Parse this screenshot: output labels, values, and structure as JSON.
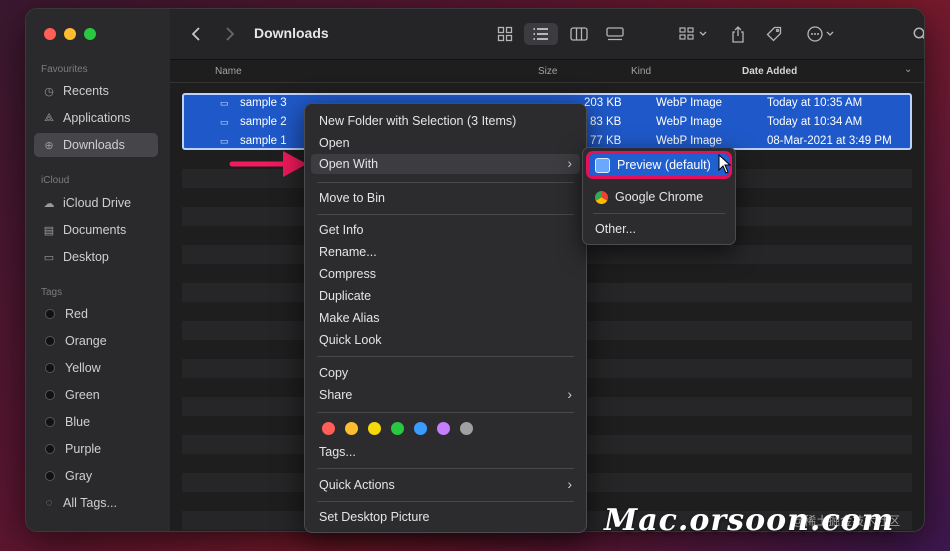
{
  "window": {
    "title": "Downloads"
  },
  "sidebar": {
    "sections": [
      {
        "title": "Favourites",
        "items": [
          {
            "label": "Recents",
            "icon": "clock-icon"
          },
          {
            "label": "Applications",
            "icon": "applications-icon"
          },
          {
            "label": "Downloads",
            "icon": "download-icon",
            "active": true
          }
        ]
      },
      {
        "title": "iCloud",
        "items": [
          {
            "label": "iCloud Drive",
            "icon": "cloud-icon"
          },
          {
            "label": "Documents",
            "icon": "document-icon"
          },
          {
            "label": "Desktop",
            "icon": "desktop-icon"
          }
        ]
      },
      {
        "title": "Tags",
        "items": [
          {
            "label": "Red",
            "icon": "tag-dot-icon"
          },
          {
            "label": "Orange",
            "icon": "tag-dot-icon"
          },
          {
            "label": "Yellow",
            "icon": "tag-dot-icon"
          },
          {
            "label": "Green",
            "icon": "tag-dot-icon"
          },
          {
            "label": "Blue",
            "icon": "tag-dot-icon"
          },
          {
            "label": "Purple",
            "icon": "tag-dot-icon"
          },
          {
            "label": "Gray",
            "icon": "tag-dot-icon"
          },
          {
            "label": "All Tags...",
            "icon": "all-tags-icon"
          }
        ]
      }
    ]
  },
  "columns": {
    "name": "Name",
    "size": "Size",
    "kind": "Kind",
    "date": "Date Added"
  },
  "files": [
    {
      "name": "sample 3",
      "size": "203 KB",
      "kind": "WebP Image",
      "date": "Today at 10:35 AM"
    },
    {
      "name": "sample 2",
      "size": "83 KB",
      "kind": "WebP Image",
      "date": "Today at 10:34 AM"
    },
    {
      "name": "sample 1",
      "size": "77 KB",
      "kind": "WebP Image",
      "date": "08-Mar-2021 at 3:49 PM"
    }
  ],
  "context_menu": {
    "new_folder": "New Folder with Selection (3 Items)",
    "open": "Open",
    "open_with": "Open With",
    "move_to_bin": "Move to Bin",
    "get_info": "Get Info",
    "rename": "Rename...",
    "compress": "Compress",
    "duplicate": "Duplicate",
    "make_alias": "Make Alias",
    "quick_look": "Quick Look",
    "copy": "Copy",
    "share": "Share",
    "tags": "Tags...",
    "quick_actions": "Quick Actions",
    "set_desktop_picture": "Set Desktop Picture",
    "tag_colors": [
      "#ff5f57",
      "#febc2e",
      "#f5d90a",
      "#28c840",
      "#3b9cff",
      "#c77dff",
      "#a0a0a0"
    ]
  },
  "submenu": {
    "preview": "Preview (default)",
    "chrome": "Google Chrome",
    "other": "Other..."
  },
  "colors": {
    "selection": "#1f59c9",
    "highlight_border": "#e4105a",
    "arrow": "#f01a5c"
  },
  "watermark": {
    "text": "Mac.orsoon.com",
    "sub": "@稀土掘金技术社区"
  }
}
